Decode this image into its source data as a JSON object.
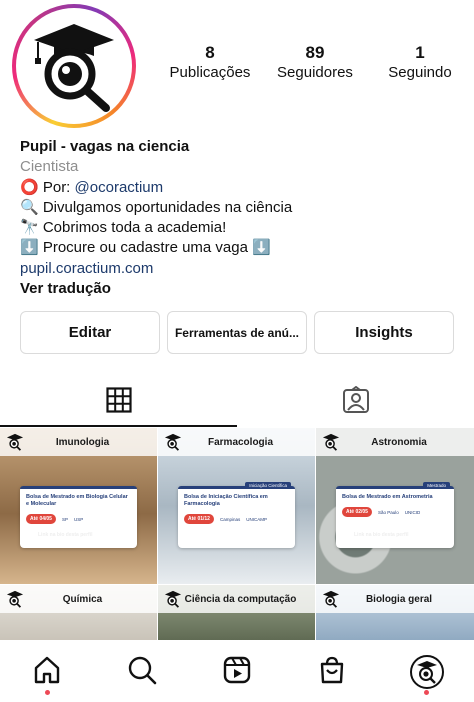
{
  "profile": {
    "stats": [
      {
        "value": "8",
        "label": "Publicações"
      },
      {
        "value": "89",
        "label": "Seguidores"
      },
      {
        "value": "1",
        "label": "Seguindo"
      }
    ]
  },
  "bio": {
    "name": "Pupil - vagas na ciencia",
    "category": "Cientista",
    "line1_prefix": "⭕ Por: ",
    "line1_mention": "@ocoractium",
    "line2": "🔍 Divulgamos oportunidades na ciência",
    "line3": "🔭 Cobrimos toda a academia!",
    "line4": "⬇️ Procure ou cadastre uma vaga ⬇️",
    "link": "pupil.coractium.com",
    "translate": "Ver tradução"
  },
  "actions": {
    "edit": "Editar",
    "tools": "Ferramentas de anú...",
    "insights": "Insights"
  },
  "posts": [
    {
      "title": "Imunologia",
      "card_text": "Bolsa de Mestrado em Biologia Celular e Molecular",
      "date": "Até 04/05",
      "location": "SP",
      "institution": "USP",
      "tag": "",
      "link_text": "Link na bio desta perfil",
      "bg": "#b08a62"
    },
    {
      "title": "Farmacologia",
      "card_text": "Bolsa de Iniciação Científica em Farmacologia",
      "date": "Até 01/12",
      "location": "Campinas",
      "institution": "UNICAMP",
      "tag": "Iniciação Científica",
      "link_text": "",
      "bg": "#9fb3c4"
    },
    {
      "title": "Astronomia",
      "card_text": "Bolsa de Mestrado em Astrometria",
      "date": "Até 02/05",
      "location": "São Paulo",
      "institution": "UNICID",
      "tag": "Mestrado",
      "link_text": "Link na bio desta perfil",
      "bg": "#a7aca9"
    },
    {
      "title": "Química",
      "bg": "#d8d5cf"
    },
    {
      "title": "Ciência da computação",
      "bg": "#7f8a72"
    },
    {
      "title": "Biologia geral",
      "bg": "#b3c7d8"
    }
  ],
  "colors": {
    "accent_blue": "#1d3a6b",
    "card_navy": "#27407a",
    "date_red": "#e0463c",
    "notification_dot": "#ed4956"
  },
  "nav": [
    "home-icon",
    "search-icon",
    "reels-icon",
    "shop-icon",
    "profile-icon"
  ]
}
